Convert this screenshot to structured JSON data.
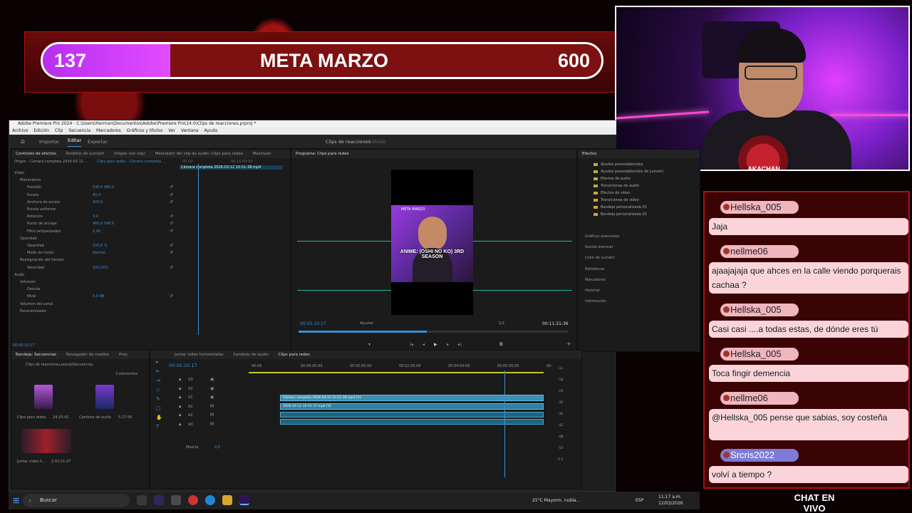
{
  "meta": {
    "current": "137",
    "title": "META MARZO",
    "goal": "600",
    "progress": 0.228
  },
  "cam": {
    "logo": "AKACHAN"
  },
  "premiere": {
    "title": "Adobe Premiere Pro 2024 - C:\\Users\\Herman\\Documentos\\Adobe\\Premiere Pro\\14.0\\Clips de reacciones.prproj *",
    "menu": [
      "Archivo",
      "Edición",
      "Clip",
      "Secuencia",
      "Marcadores",
      "Gráficos y títulos",
      "Ver",
      "Ventana",
      "Ayuda"
    ],
    "workspace": {
      "home": "⌂",
      "import": "Importar",
      "edit": "Editar",
      "export": "Exportar",
      "project": "Clips de reacciones",
      "status": "Editado"
    },
    "effect_controls": {
      "tabs": [
        "Controles de efectos",
        "Ámbitos de Lumetri",
        "Origen (sin clip)",
        "Mezclador del clip de audio: Clips para redes",
        "Mezclado"
      ],
      "source": "Origen - Cámara completa 2026-03-12 ...",
      "seq": "Clips para redes - Cámara completa...",
      "clip_label": "Cámara completa 2026-03-12 10-51-38.mp4",
      "rows": [
        {
          "label": "Vídeo",
          "value": ""
        },
        {
          "label": "Movimiento",
          "value": ""
        },
        {
          "label": "Posición",
          "value": "540,0   960,0"
        },
        {
          "label": "Escala",
          "value": "80,0"
        },
        {
          "label": "Anchura de escala",
          "value": "100,0"
        },
        {
          "label": "Escala uniforme",
          "value": ""
        },
        {
          "label": "Rotación",
          "value": "0,0"
        },
        {
          "label": "Punto de anclaje",
          "value": "960,0   540,0"
        },
        {
          "label": "Filtro antiparpadeo",
          "value": "0,00"
        },
        {
          "label": "Opacidad",
          "value": ""
        },
        {
          "label": "Opacidad",
          "value": "100,0 %"
        },
        {
          "label": "Modo de fusión",
          "value": "Normal"
        },
        {
          "label": "Reasignación del tiempo",
          "value": ""
        },
        {
          "label": "Velocidad",
          "value": "100,00%"
        },
        {
          "label": "Audio",
          "value": ""
        },
        {
          "label": "Volumen",
          "value": ""
        },
        {
          "label": "Desviar",
          "value": ""
        },
        {
          "label": "Nivel",
          "value": "0,0 dB"
        },
        {
          "label": "Volumen del canal",
          "value": ""
        },
        {
          "label": "Panoramizador",
          "value": ""
        }
      ],
      "time_a": "00:00",
      "time_b": "00:15:00:00",
      "timecode": "00:05:10:17"
    },
    "program": {
      "tab": "Programa: Clips para redes",
      "timecode": "00:05:10:17",
      "fit": "Ajustar",
      "quality": "1/2",
      "duration": "00:11:21:36",
      "frame_title": "META MARZO",
      "subtitle": "ANIME: (OSHI NO KO) 3RD SEASON"
    },
    "project": {
      "tabs": [
        "Bandeja: Secuencias",
        "Navegador de medios",
        "Proy"
      ],
      "path": "Clips de reacciones.prproj\\Secuencias",
      "count": "3 elementos",
      "items": [
        {
          "name": "Clips para redes",
          "dur": "24:20:42"
        },
        {
          "name": "Cambios de audio",
          "dur": "5:27:56"
        },
        {
          "name": "Juntar video h...",
          "dur": "2:43:21:37"
        }
      ]
    },
    "timeline": {
      "tabs": [
        "Juntar video horizontales",
        "Cambios de audio",
        "Clips para redes"
      ],
      "timecode": "00:05:10:17",
      "ruler": [
        "00:00",
        "00:00:00:00",
        "00:00:05:00",
        "00:02:00:00",
        "00:04:00:00",
        "00:05:00:00",
        "00:"
      ],
      "tracks": [
        "V3",
        "V2",
        "V1",
        "A1",
        "A2",
        "A3"
      ],
      "mix": "Mezcla",
      "mix_value": "0,0",
      "clip_v2": "Cámara completa 2026-03-12 10-51-38.mp4 [V]",
      "clip_v1": "2026-03-12 10-51-37.mp4 [V]"
    },
    "effects": {
      "tab": "Efectos",
      "folders": [
        "Ajustes preestablecidos",
        "Ajustes preestablecidos de Lumetri",
        "Efectos de audio",
        "Transiciones de audio",
        "Efectos de vídeo",
        "Transiciones de vídeo",
        "Bandeja personalizada 01",
        "Bandeja personalizada 02"
      ],
      "panels": [
        "Gráficos esenciales",
        "Sonido esencial",
        "Color de Lumetri",
        "Bibliotecas",
        "Marcadores",
        "Historial",
        "Información"
      ]
    },
    "scale": [
      "-12",
      "-18",
      "-24",
      "-30",
      "-36",
      "-42",
      "-48",
      "-54",
      "S S"
    ]
  },
  "chat": {
    "label": "CHAT EN VIVO",
    "messages": [
      {
        "user": "Hellska_005",
        "text": "Jaja",
        "badge": false
      },
      {
        "user": "nellme06",
        "text": "ajaajajaja que ahces en la calle viendo porquerais cachaa ?",
        "badge": false
      },
      {
        "user": "Hellska_005",
        "text": "Casi casi ....a todas estas, de dónde eres tú",
        "badge": false
      },
      {
        "user": "Hellska_005",
        "text": "Toca fingir demencia",
        "badge": false
      },
      {
        "user": "nellme06",
        "text": "@Hellska_005 pense que sabias, soy costeña",
        "badge": false
      },
      {
        "user": "Srcris2022",
        "text": "volví a tiempo ?",
        "badge": true
      }
    ]
  },
  "taskbar": {
    "search": "Buscar",
    "weather": "25°C  Mayorm. nubla...",
    "lang": "ESP",
    "time": "11:17 a.m.",
    "date": "12/03/2026"
  }
}
